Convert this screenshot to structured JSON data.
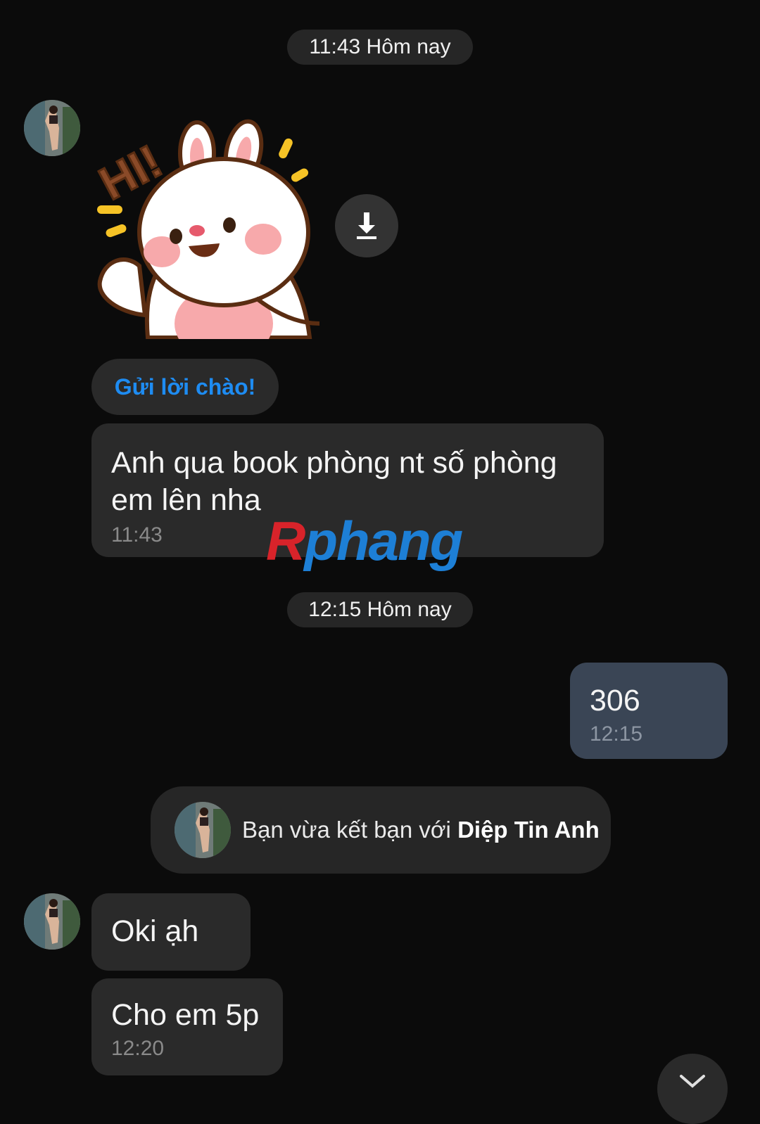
{
  "dividers": [
    {
      "label": "11:43 Hôm nay"
    },
    {
      "label": "12:15 Hôm nay"
    }
  ],
  "sticker": {
    "name": "HI! bunny sticker",
    "caption": "HI!"
  },
  "greeting": {
    "label": "Gửi lời chào!"
  },
  "messages": [
    {
      "text": "Anh qua book phòng nt số phòng em lên nha",
      "time": "11:43"
    },
    {
      "text": "306",
      "time": "12:15"
    },
    {
      "text": "Oki ạh"
    },
    {
      "text": "Cho em 5p",
      "time": "12:20"
    }
  ],
  "system_note": {
    "prefix": "Bạn vừa kết bạn với ",
    "name": "Diệp Tin Anh"
  },
  "watermark": {
    "part1": "R",
    "part2": "phang"
  },
  "icons": {
    "download": "download-icon",
    "scroll": "chevron-down-icon",
    "avatar": "avatar"
  },
  "colors": {
    "background": "#0b0b0b",
    "bubble_incoming": "#2a2a2a",
    "bubble_outgoing": "#3a4555",
    "greeting_link": "#1e8cf2"
  }
}
